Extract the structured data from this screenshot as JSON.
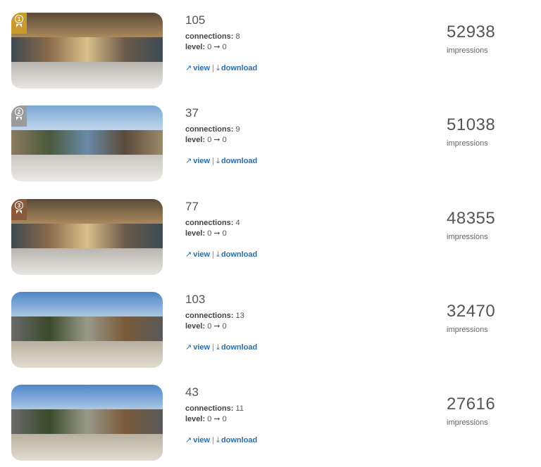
{
  "labels": {
    "connections": "connections:",
    "level": "level:",
    "view": "view",
    "download": "download",
    "separator": "|",
    "impressions": "impressions",
    "arrow": "0 ➞ 0"
  },
  "icons": {
    "view": "external-link-icon",
    "download": "download-icon",
    "rank": "award-ribbon-icon"
  },
  "colors": {
    "link": "#2a6fb0",
    "gold": "#c99a2e",
    "silver": "#9b9b9b",
    "bronze": "#8b5a3c"
  },
  "items": [
    {
      "rank": "1",
      "id": "105",
      "connections": "8",
      "level_from": "0",
      "level_to": "0",
      "impressions": "52938",
      "scene": "indoor-warm"
    },
    {
      "rank": "2",
      "id": "37",
      "connections": "9",
      "level_from": "0",
      "level_to": "0",
      "impressions": "51038",
      "scene": "indoor-sky"
    },
    {
      "rank": "3",
      "id": "77",
      "connections": "4",
      "level_from": "0",
      "level_to": "0",
      "impressions": "48355",
      "scene": "indoor-warm"
    },
    {
      "rank": "",
      "id": "103",
      "connections": "13",
      "level_from": "0",
      "level_to": "0",
      "impressions": "32470",
      "scene": "outdoor"
    },
    {
      "rank": "",
      "id": "43",
      "connections": "11",
      "level_from": "0",
      "level_to": "0",
      "impressions": "27616",
      "scene": "outdoor"
    }
  ]
}
